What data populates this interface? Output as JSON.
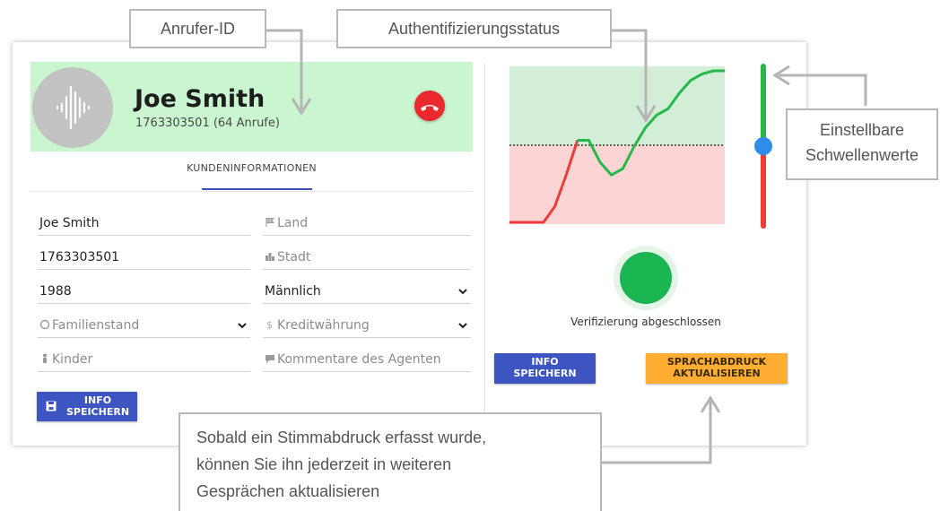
{
  "caller": {
    "name": "Joe Smith",
    "number_line": "1763303501 (64 Anrufe)"
  },
  "tab": {
    "label": "KUNDENINFORMATIONEN"
  },
  "form": {
    "name_value": "Joe Smith",
    "phone_value": "1763303501",
    "year_value": "1988",
    "gender_value": "Männlich",
    "land_placeholder": "Land",
    "stadt_placeholder": "Stadt",
    "familienstand_placeholder": "Familienstand",
    "kreditwaehrung_placeholder": "Kreditwährung",
    "kinder_placeholder": "Kinder",
    "kommentare_placeholder": "Kommentare des Agenten",
    "save_line1": "INFO",
    "save_line2": "SPEICHERN"
  },
  "auth": {
    "status_text": "Verifizierung abgeschlossen",
    "status_color": "#1ab550",
    "save_line1": "INFO",
    "save_line2": "SPEICHERN",
    "voiceprint_line1": "SPRACHABDRUCK",
    "voiceprint_line2": "AKTUALISIEREN"
  },
  "chart_data": {
    "type": "line",
    "series": [
      {
        "values": [
          0,
          0,
          0,
          0,
          0.1,
          0.3,
          0.52,
          0.52,
          0.38,
          0.3,
          0.34,
          0.48,
          0.6,
          0.68,
          0.72,
          0.82,
          0.9,
          0.94,
          0.96,
          0.96
        ]
      }
    ],
    "threshold": 0.5,
    "ylim": [
      0,
      1
    ],
    "colors": {
      "above": "#27b84a",
      "below": "#ee3b3b",
      "bg_above": "#d2eed7",
      "bg_below": "#fcd4d4"
    }
  },
  "slider": {
    "threshold_fraction": 0.5,
    "colors": {
      "top": "#27b84a",
      "bottom": "#ee3b3b",
      "handle": "#2f8ce8"
    }
  },
  "callouts": {
    "anrufer_id": "Anrufer-ID",
    "auth_status": "Authentifizierungsstatus",
    "thresholds_line1": "Einstellbare",
    "thresholds_line2": "Schwellenwerte",
    "voiceprint_line1": "Sobald ein Stimmabdruck erfasst wurde,",
    "voiceprint_line2": "können Sie ihn jederzeit in weiteren",
    "voiceprint_line3": "Gesprächen aktualisieren"
  },
  "icons": {
    "avatar": "voice-wave-icon",
    "hangup": "hang-up-phone-icon",
    "land": "flag-icon",
    "stadt": "city-icon",
    "familienstand": "ring-icon",
    "kreditwaehrung": "dollar-icon",
    "kinder": "child-icon",
    "kommentare": "comment-icon",
    "save": "floppy-disk-icon",
    "dropdown": "chevron-down-icon"
  }
}
